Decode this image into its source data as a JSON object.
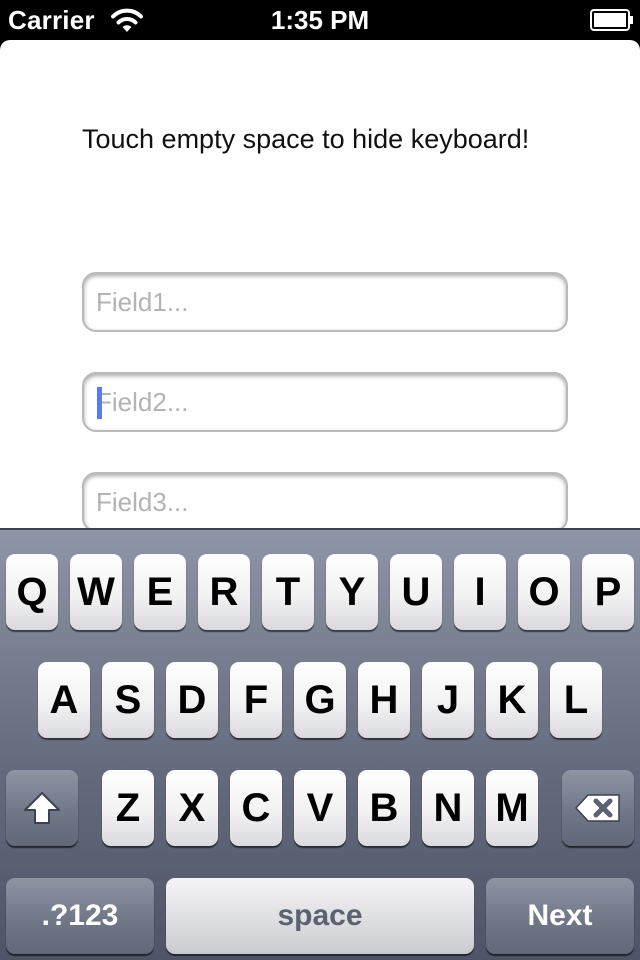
{
  "status_bar": {
    "carrier": "Carrier",
    "time": "1:35 PM",
    "wifi_icon": "wifi-icon",
    "battery_icon": "battery-icon"
  },
  "content": {
    "hint": "Touch empty space to hide keyboard!",
    "fields": [
      {
        "placeholder": "Field1...",
        "value": ""
      },
      {
        "placeholder": "Field2...",
        "value": "",
        "focused": true
      },
      {
        "placeholder": "Field3...",
        "value": ""
      }
    ]
  },
  "keyboard": {
    "row1": [
      "Q",
      "W",
      "E",
      "R",
      "T",
      "Y",
      "U",
      "I",
      "O",
      "P"
    ],
    "row2": [
      "A",
      "S",
      "D",
      "F",
      "G",
      "H",
      "J",
      "K",
      "L"
    ],
    "row3": [
      "Z",
      "X",
      "C",
      "V",
      "B",
      "N",
      "M"
    ],
    "shift_icon": "shift-arrow-icon",
    "delete_icon": "backspace-icon",
    "numbers_label": ".?123",
    "space_label": "space",
    "return_label": "Next"
  },
  "colors": {
    "caret": "#5b7cf0",
    "keyboard_bg": "#646b7c"
  }
}
